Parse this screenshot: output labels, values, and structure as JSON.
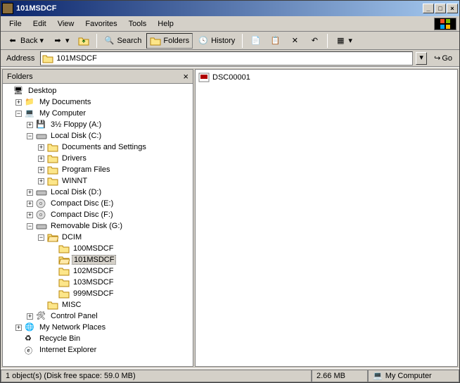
{
  "title": "101MSDCF",
  "menus": [
    "File",
    "Edit",
    "View",
    "Favorites",
    "Tools",
    "Help"
  ],
  "toolbar": {
    "back": "Back",
    "search": "Search",
    "folders": "Folders",
    "history": "History"
  },
  "address": {
    "label": "Address",
    "value": "101MSDCF",
    "go": "Go"
  },
  "folders_pane": {
    "title": "Folders"
  },
  "tree": {
    "desktop": "Desktop",
    "mydocs": "My Documents",
    "mycomp": "My Computer",
    "floppy": "3½ Floppy (A:)",
    "localc": "Local Disk (C:)",
    "docsettings": "Documents and Settings",
    "drivers": "Drivers",
    "progfiles": "Program Files",
    "winnt": "WINNT",
    "locald": "Local Disk (D:)",
    "cde": "Compact Disc (E:)",
    "cdf": "Compact Disc (F:)",
    "removg": "Removable Disk (G:)",
    "dcim": "DCIM",
    "f100": "100MSDCF",
    "f101": "101MSDCF",
    "f102": "102MSDCF",
    "f103": "103MSDCF",
    "f999": "999MSDCF",
    "misc": "MISC",
    "cpanel": "Control Panel",
    "netplaces": "My Network Places",
    "recycle": "Recycle Bin",
    "ie": "Internet Explorer"
  },
  "content": {
    "file1": "DSC00001"
  },
  "status": {
    "text": "1 object(s) (Disk free space: 59.0 MB)",
    "size": "2.66 MB",
    "location": "My Computer"
  }
}
